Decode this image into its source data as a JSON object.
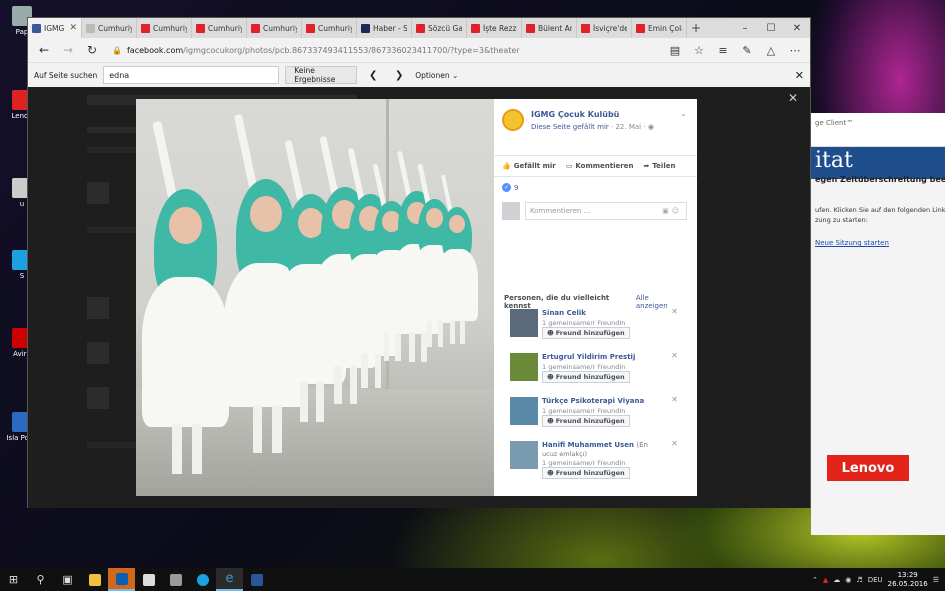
{
  "desktop": {
    "icons": [
      {
        "label": "Pap",
        "color": "#9aa"
      },
      {
        "label": "Lenov",
        "color": "#d22"
      },
      {
        "label": "u",
        "color": "#ccc"
      },
      {
        "label": "S",
        "color": "#1ba1e2"
      },
      {
        "label": "Avira",
        "color": "#c00"
      },
      {
        "label": "Isla Politi",
        "color": "#2a6ac0"
      }
    ]
  },
  "browser": {
    "tabs": [
      {
        "label": "IGMG",
        "fav_color": "#3b5998",
        "active": true
      },
      {
        "label": "Cumhuriy",
        "fav_color": "#bbbbbb"
      },
      {
        "label": "Cumhuriy",
        "fav_color": "#e0202a"
      },
      {
        "label": "Cumhuriy",
        "fav_color": "#e0202a"
      },
      {
        "label": "Cumhuriy",
        "fav_color": "#e0202a"
      },
      {
        "label": "Cumhuriy",
        "fav_color": "#e0202a"
      },
      {
        "label": "Haber - S",
        "fav_color": "#1c2a5a"
      },
      {
        "label": "Sözcü Ga",
        "fav_color": "#e0202a"
      },
      {
        "label": "İşte Rezza",
        "fav_color": "#e0202a"
      },
      {
        "label": "Bülent Arı",
        "fav_color": "#e0202a"
      },
      {
        "label": "İsviçre'de",
        "fav_color": "#e0202a"
      },
      {
        "label": "Emin Çola",
        "fav_color": "#e0202a"
      }
    ],
    "url_host": "facebook.com",
    "url_path": "/igmgcocukorg/photos/pcb.867337493411553/867336023411700/?type=3&theater",
    "find": {
      "label": "Auf Seite suchen",
      "value": "edna",
      "result": "Keine Ergebnisse",
      "options": "Optionen"
    }
  },
  "post": {
    "page_name": "IGMG Çocuk Kulübü",
    "liked_text": "Diese Seite gefällt mir",
    "date": "· 22. Mai ·",
    "like_label": "Gefällt mir",
    "comment_label": "Kommentieren",
    "share_label": "Teilen",
    "like_count": "9",
    "comment_placeholder": "Kommentieren ...",
    "pymk_title": "Personen, die du vielleicht kennst",
    "pymk_all": "Alle anzeigen",
    "people": [
      {
        "name": "Sinan Celik",
        "sub": "",
        "mutual": "1 gemeinsame/r FreundIn",
        "button": "Freund hinzufügen",
        "photo": "#5a6a7a"
      },
      {
        "name": "Ertugrul Yildirim Prestij",
        "sub": "",
        "mutual": "1 gemeinsame/r FreundIn",
        "button": "Freund hinzufügen",
        "photo": "#6a8a3a"
      },
      {
        "name": "Türkçe Psikoterapi Viyana",
        "sub": "",
        "mutual": "1 gemeinsame/r FreundIn",
        "button": "Freund hinzufügen",
        "photo": "#5a8aa8"
      },
      {
        "name": "Hanifi Muhammet Usen",
        "sub": "(En",
        "sub2": "ucuz emlakçı)",
        "mutual": "1 gemeinsame/r FreundIn",
        "button": "Freund hinzufügen",
        "photo": "#7a9ab0"
      }
    ]
  },
  "sidewindow": {
    "header": "ge Client™",
    "banner": "itat",
    "message": "egen Zeitüberschreitung beend",
    "text1": "ufen. Klicken Sie auf den folgenden Link, u",
    "text2": "zung zu starten:",
    "link": "Neue Sitzung starten",
    "brand": "Lenovo"
  },
  "taskbar": {
    "time": "13:29",
    "date": "26.05.2016",
    "lang": "DEU"
  }
}
